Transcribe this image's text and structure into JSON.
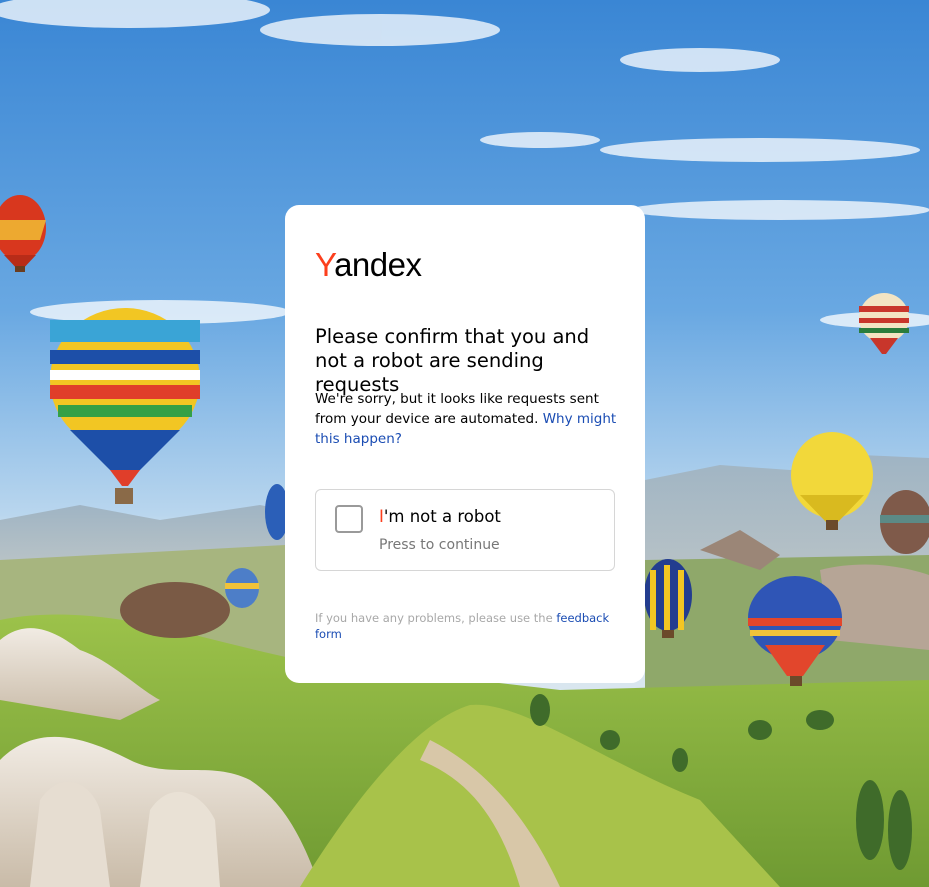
{
  "brand": {
    "logo_first": "Y",
    "logo_rest": "andex",
    "accent_color": "#fc3f1d",
    "link_color": "#1a4cb3"
  },
  "card": {
    "title": "Please confirm that you and not a robot are sending requests",
    "description": "We're sorry, but it looks like requests sent from your device are automated.",
    "why_link": "Why might this happen?",
    "captcha": {
      "label_first": "I",
      "label_rest": "'m not a robot",
      "sublabel": "Press to continue"
    },
    "footer_text": "If you have any problems, please use the",
    "feedback_link": "feedback form"
  },
  "background": {
    "scene": "hot-air-balloons-valley"
  }
}
